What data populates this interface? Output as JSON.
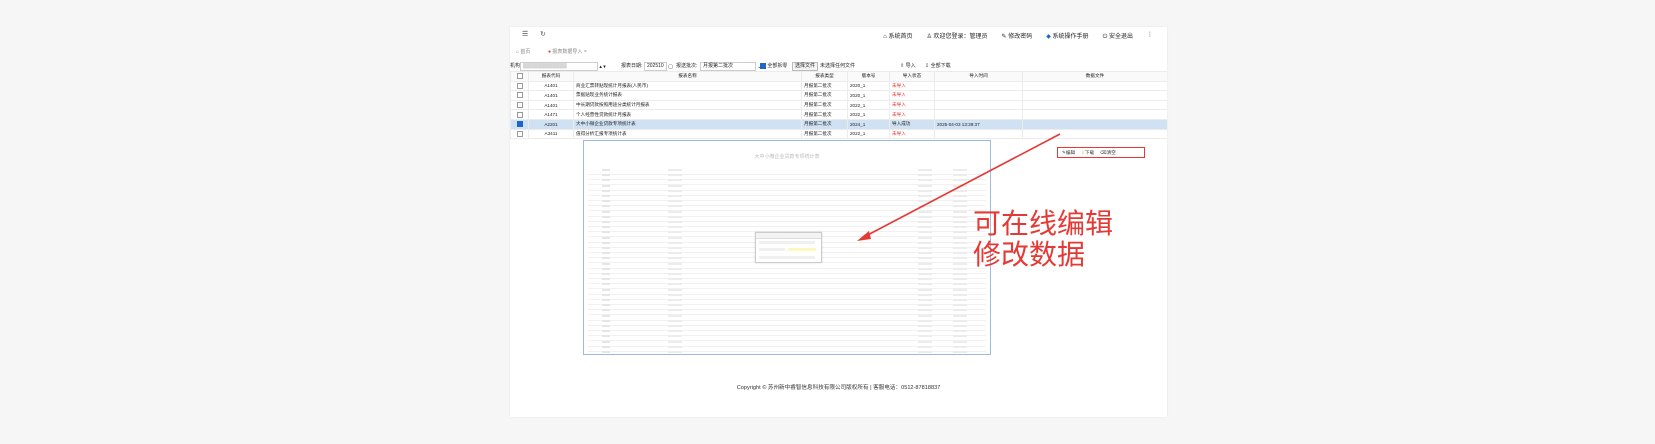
{
  "topbar": {
    "menu_icon": "menu-icon",
    "refresh_icon": "refresh-icon",
    "links": [
      "系统首页",
      "欢迎您登录：管理员",
      "修改密码",
      "系统操作手册",
      "安全退出"
    ],
    "more_icon": "more-vertical-icon"
  },
  "tabs": {
    "home": "首页",
    "active": "报表数据导入"
  },
  "filter": {
    "org_label": "机构:",
    "period_label": "报表日期:",
    "period_value": "202510",
    "batch_label": "报送批次:",
    "batch_value": "月报第二批次",
    "check_label": "全部拆零",
    "choose_file": "选择文件",
    "no_file": "未选择任何文件",
    "import": "导入",
    "download_all": "全部下载"
  },
  "table": {
    "headers": [
      "报表代码",
      "报表名称",
      "报表类型",
      "版本号",
      "导入状态",
      "导入时间",
      "数据文件"
    ],
    "rows": [
      {
        "code": "A1401",
        "name": "商业汇票转贴现统计月报表(人民币)",
        "type": "月报第二批次",
        "version": "2020_1",
        "status": "未导入",
        "time": "",
        "selected": false
      },
      {
        "code": "A1401",
        "name": "票据贴现业务统计报表",
        "type": "月报第二批次",
        "version": "2020_1",
        "status": "未导入",
        "time": "",
        "selected": false
      },
      {
        "code": "A1401",
        "name": "中长期贷款按照用途分类统计月报表",
        "type": "月报第二批次",
        "version": "2022_1",
        "status": "未导入",
        "time": "",
        "selected": false
      },
      {
        "code": "A1471",
        "name": "个人经营性贷款统计月报表",
        "type": "月报第二批次",
        "version": "2022_1",
        "status": "未导入",
        "time": "",
        "selected": false
      },
      {
        "code": "A2201",
        "name": "大中小微企业贷款专项统计表",
        "type": "月报第二批次",
        "version": "2024_1",
        "status": "导入成功",
        "time": "2025-04-03 13:39:37",
        "selected": true
      },
      {
        "code": "A3411",
        "name": "值得分析汇报专项统计表",
        "type": "月报第二批次",
        "version": "2022_1",
        "status": "未导入",
        "time": "",
        "selected": false
      }
    ],
    "actions": [
      "编辑",
      "下载",
      "清空"
    ]
  },
  "embedded": {
    "title": "大中小微企业贷款专项统计表",
    "popup_title": "数据编辑"
  },
  "footer": "Copyright © 苏州新中睿智信息科技有限公司版权所有 | 客服电话：0512-87818837",
  "annotation": [
    "可在线编辑",
    "修改数据"
  ],
  "colors": {
    "accent": "#1e66c8",
    "highlight": "#e53935",
    "selected_row": "#cfe1f3"
  }
}
